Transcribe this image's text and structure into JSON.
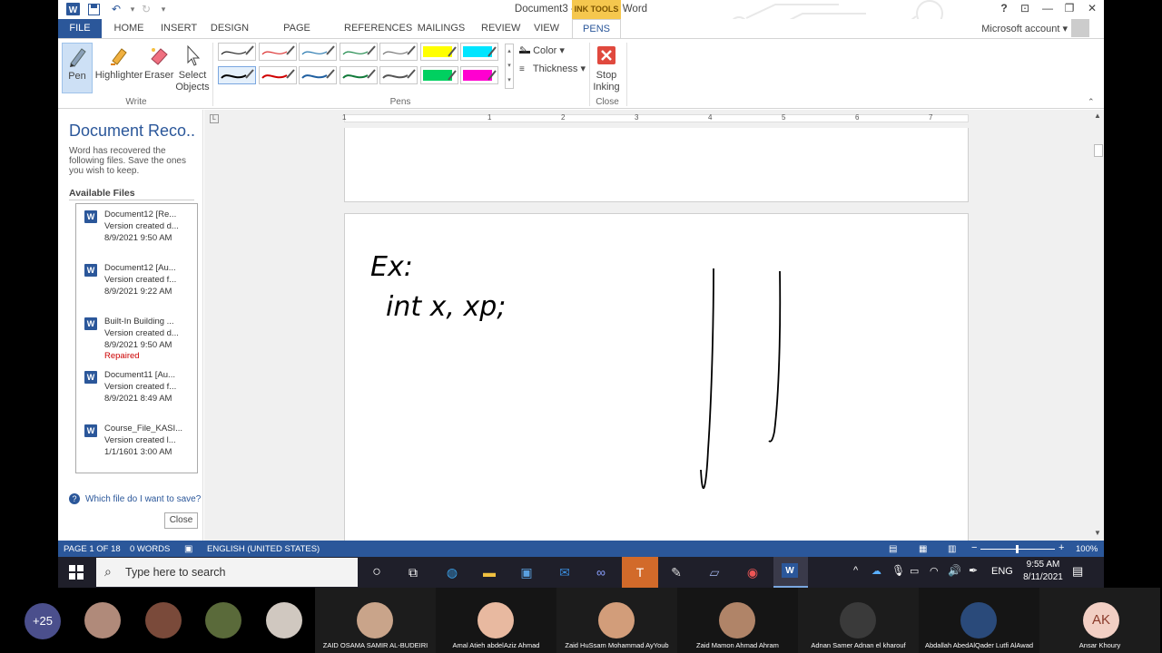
{
  "window": {
    "title": "Document3 - Microsoft Word",
    "context_tab_label": "INK TOOLS",
    "account": "Microsoft account",
    "help": "?",
    "controls": {
      "minimize": "—",
      "restore": "❐",
      "close": "✕",
      "ribbon_opts": "⊡"
    }
  },
  "tabs": [
    "FILE",
    "HOME",
    "INSERT",
    "DESIGN",
    "PAGE LAYOUT",
    "REFERENCES",
    "MAILINGS",
    "REVIEW",
    "VIEW",
    "PENS"
  ],
  "ribbon": {
    "write": {
      "pen": "Pen",
      "highlighter": "Highlighter",
      "eraser": "Eraser",
      "select_1": "Select",
      "select_2": "Objects",
      "group": "Write"
    },
    "pens": {
      "color": "Color",
      "thickness": "Thickness",
      "group": "Pens",
      "swatches_top": [
        "#222222",
        "#d33",
        "#2a7ab0",
        "#1f8a4c",
        "#777777",
        "#ffff00",
        "#00e5ff"
      ],
      "swatches_bottom": [
        "#000000",
        "#d00000",
        "#1f5fa0",
        "#117a3a",
        "#555555",
        "#00d060",
        "#ff00d0"
      ]
    },
    "close": {
      "stop_1": "Stop",
      "stop_2": "Inking",
      "group": "Close"
    }
  },
  "recovery": {
    "title": "Document Reco...",
    "description": "Word has recovered the following files.  Save the ones you wish to keep.",
    "available": "Available Files",
    "files": [
      {
        "name": "Document12  [Re...",
        "line2": "Version created d...",
        "date": "8/9/2021 9:50 AM",
        "status": ""
      },
      {
        "name": "Document12  [Au...",
        "line2": "Version created f...",
        "date": "8/9/2021 9:22 AM",
        "status": ""
      },
      {
        "name": "Built-In Building ...",
        "line2": "Version created d...",
        "date": "8/9/2021 9:50 AM",
        "status": "Repaired"
      },
      {
        "name": "Document11  [Au...",
        "line2": "Version created f...",
        "date": "8/9/2021 8:49 AM",
        "status": ""
      },
      {
        "name": "Course_File_KASI...",
        "line2": "Version created l...",
        "date": "1/1/1601 3:00 AM",
        "status": ""
      }
    ],
    "help_link": "Which file do I want to save?",
    "close": "Close"
  },
  "ruler": [
    "1",
    "1",
    "2",
    "3",
    "4",
    "5",
    "6",
    "7"
  ],
  "ink_text": {
    "line1": "Ex:",
    "line2": "int x, xp;"
  },
  "status": {
    "page": "PAGE 1 OF 18",
    "words": "0 WORDS",
    "language": "ENGLISH (UNITED STATES)",
    "zoom": "100%",
    "zoom_minus": "−",
    "zoom_plus": "+"
  },
  "taskbar": {
    "search_placeholder": "Type here to search",
    "lang": "ENG",
    "time": "9:55 AM",
    "date": "8/11/2021"
  },
  "meeting": {
    "more_count": "+25",
    "self_initials": "AK",
    "participants": [
      "ZAID OSAMA SAMIR AL-BUDEIRI",
      "Amal Atieh abdelAziz Ahmad",
      "Zaid HuSsam Mohammad AyYoub",
      "Zaid Mamon Ahmad Ahram",
      "Adnan Samer Adnan el kharouf",
      "Abdallah AbedAlQader Lutfi AlAwad",
      "Ansar Khoury"
    ]
  }
}
